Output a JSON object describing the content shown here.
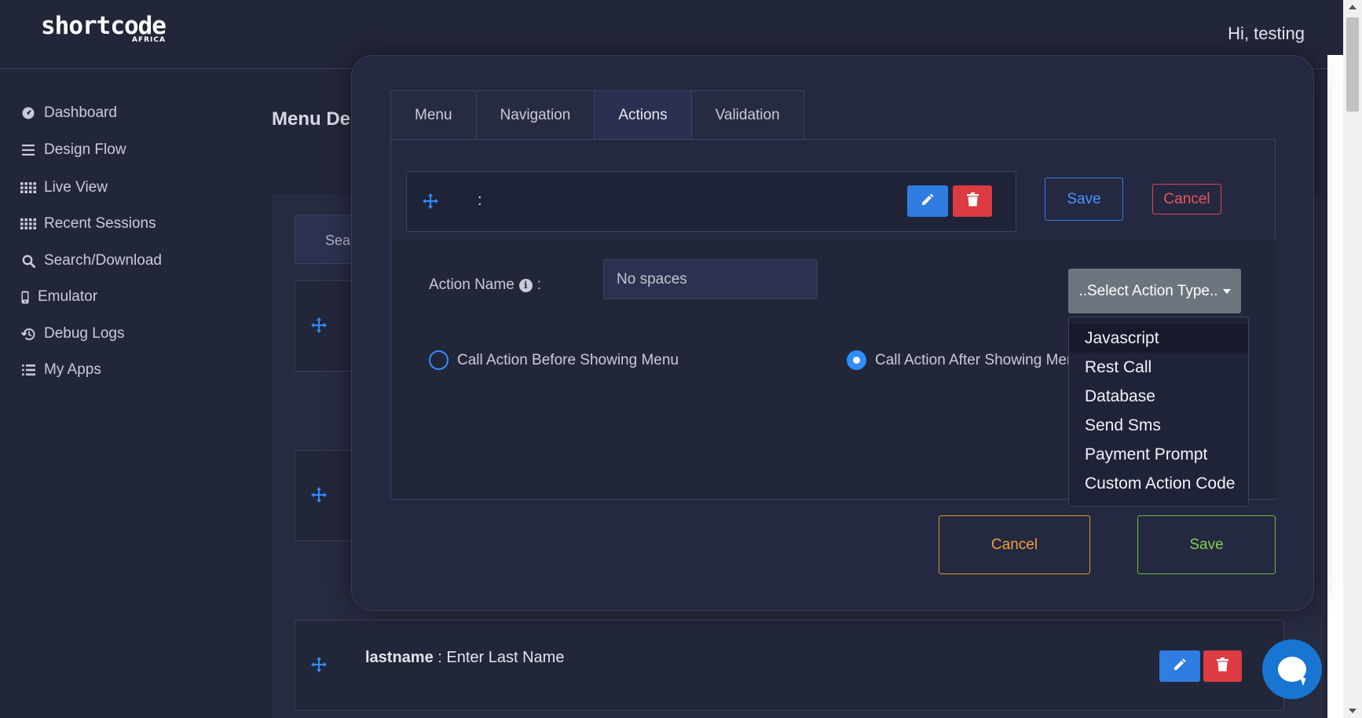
{
  "header": {
    "logo_main": "shortcode",
    "logo_sub": "AFRICA",
    "greeting": "Hi, testing"
  },
  "sidebar": {
    "items": [
      {
        "label": "Dashboard",
        "icon": "dashboard-icon"
      },
      {
        "label": "Design Flow",
        "icon": "menu-lines-icon"
      },
      {
        "label": "Live View",
        "icon": "grid-dots-icon"
      },
      {
        "label": "Recent Sessions",
        "icon": "grid-dots-icon"
      },
      {
        "label": "Search/Download",
        "icon": "search-icon"
      },
      {
        "label": "Emulator",
        "icon": "phone-icon"
      },
      {
        "label": "Debug Logs",
        "icon": "history-icon"
      },
      {
        "label": "My Apps",
        "icon": "list-icon"
      }
    ]
  },
  "page": {
    "title": "Menu Des",
    "search_partial": "Sear",
    "bottom_card": {
      "name": "lastname",
      "separator": " : ",
      "text": "Enter Last Name"
    }
  },
  "modal": {
    "tabs": [
      "Menu",
      "Navigation",
      "Actions",
      "Validation"
    ],
    "active_tab": "Actions",
    "action_row": {
      "colon": ":"
    },
    "save_small": "Save",
    "cancel_small": "Cancel",
    "action_name_label": "Action Name",
    "action_name_suffix": ":",
    "action_name_placeholder": "No spaces",
    "select_action_type": "..Select Action Type..",
    "radio_before": "Call Action Before Showing Menu",
    "radio_after": "Call Action After Showing Menu",
    "radio_selected": "after",
    "dropdown_options": [
      "Javascript",
      "Rest Call",
      "Database",
      "Send Sms",
      "Payment Prompt",
      "Custom Action Code"
    ],
    "dropdown_highlighted": "Javascript",
    "cancel_large": "Cancel",
    "save_large": "Save"
  },
  "colors": {
    "background": "#222639",
    "accent_blue": "#2f8dff",
    "danger_red": "#dc3b41",
    "warning_orange": "#f0a13b",
    "success_green": "#7ed14a"
  }
}
